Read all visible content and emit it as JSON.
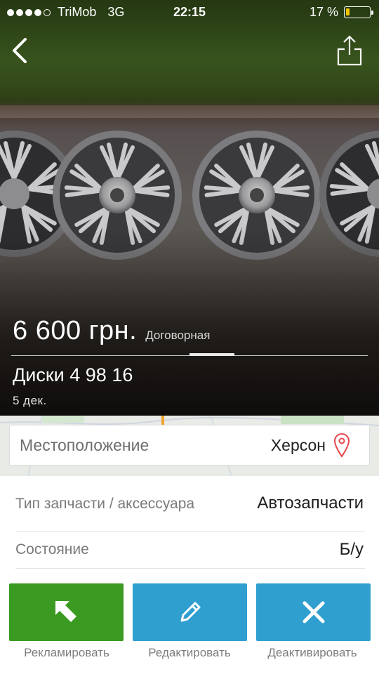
{
  "status_bar": {
    "carrier": "TriMob",
    "network": "3G",
    "time": "22:15",
    "battery_percent": "17 %",
    "battery_level": 0.17,
    "signal_bars_filled": 4,
    "signal_bars_total": 5
  },
  "nav": {
    "back_icon": "chevron-left-icon",
    "share_icon": "share-icon"
  },
  "listing": {
    "price": "6 600 грн.",
    "price_note": "Договорная",
    "title": "Диски 4 98 16",
    "date": "5  дек."
  },
  "location": {
    "label": "Местоположение",
    "city": "Херсон",
    "icon": "map-pin-icon",
    "pin_color": "#e8474c"
  },
  "details": [
    {
      "key": "Тип запчасти / аксессуара",
      "value": "Автозапчасти"
    },
    {
      "key": "Состояние",
      "value": "Б/у"
    }
  ],
  "actions": [
    {
      "label": "Рекламировать",
      "icon": "arrow-up-left-icon",
      "color": "#3b9a21"
    },
    {
      "label": "Редактировать",
      "icon": "pencil-icon",
      "color": "#2f9fd0"
    },
    {
      "label": "Деактивировать",
      "icon": "close-icon",
      "color": "#2f9fd0"
    }
  ]
}
